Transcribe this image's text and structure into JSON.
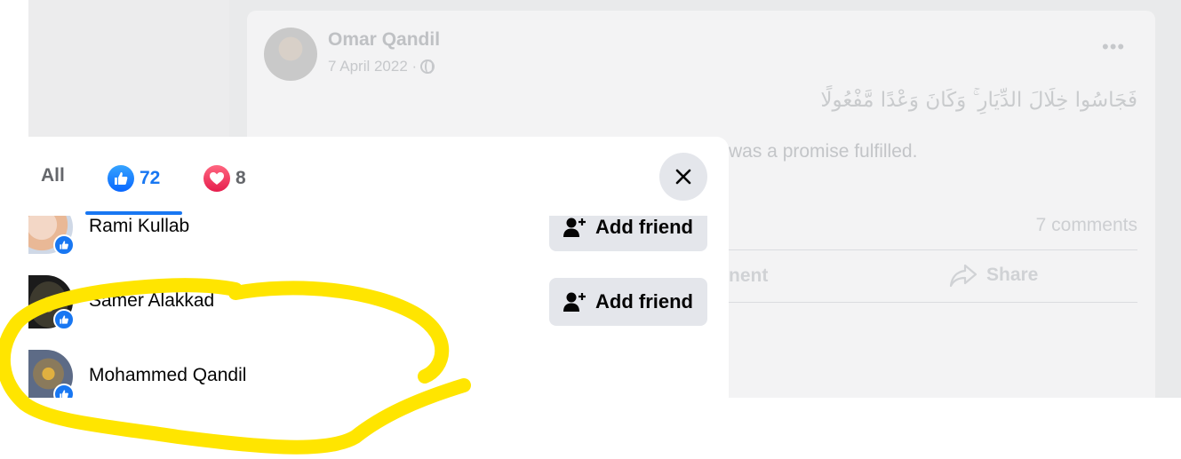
{
  "post": {
    "author": "Omar Qandil",
    "date": "7 April 2022 ·",
    "more_label": "•••",
    "arabic_text": "فَجَاسُوا خِلَالَ الدِّيَارِ ۚ وَكَانَ وَعْدًا مَّفْعُولًا",
    "translation_fragment": "was a promise fulfilled.",
    "comments_count": "7 comments",
    "comment_action_fragment": "nent",
    "share_label": "Share"
  },
  "reactions_modal": {
    "tabs": [
      {
        "label": "All"
      },
      {
        "icon": "like-icon",
        "count": "72"
      },
      {
        "icon": "heart-icon",
        "count": "8"
      }
    ],
    "selected_tab": 1,
    "close_icon": "close-icon",
    "people": [
      {
        "name": "Rami Kullab",
        "reaction": "like-icon",
        "action": "Add friend"
      },
      {
        "name": "Samer Alakkad",
        "reaction": "like-icon",
        "action": "Add friend"
      },
      {
        "name": "Mohammed Qandil",
        "reaction": "like-icon",
        "action": null
      }
    ]
  },
  "annotation": {
    "type": "yellow-freehand-circle",
    "color": "#ffe500"
  },
  "colors": {
    "accent_blue": "#1877f2",
    "love_red": "#e61e4d",
    "button_grey": "#e4e6eb",
    "backdrop": "#e9eaeb"
  }
}
